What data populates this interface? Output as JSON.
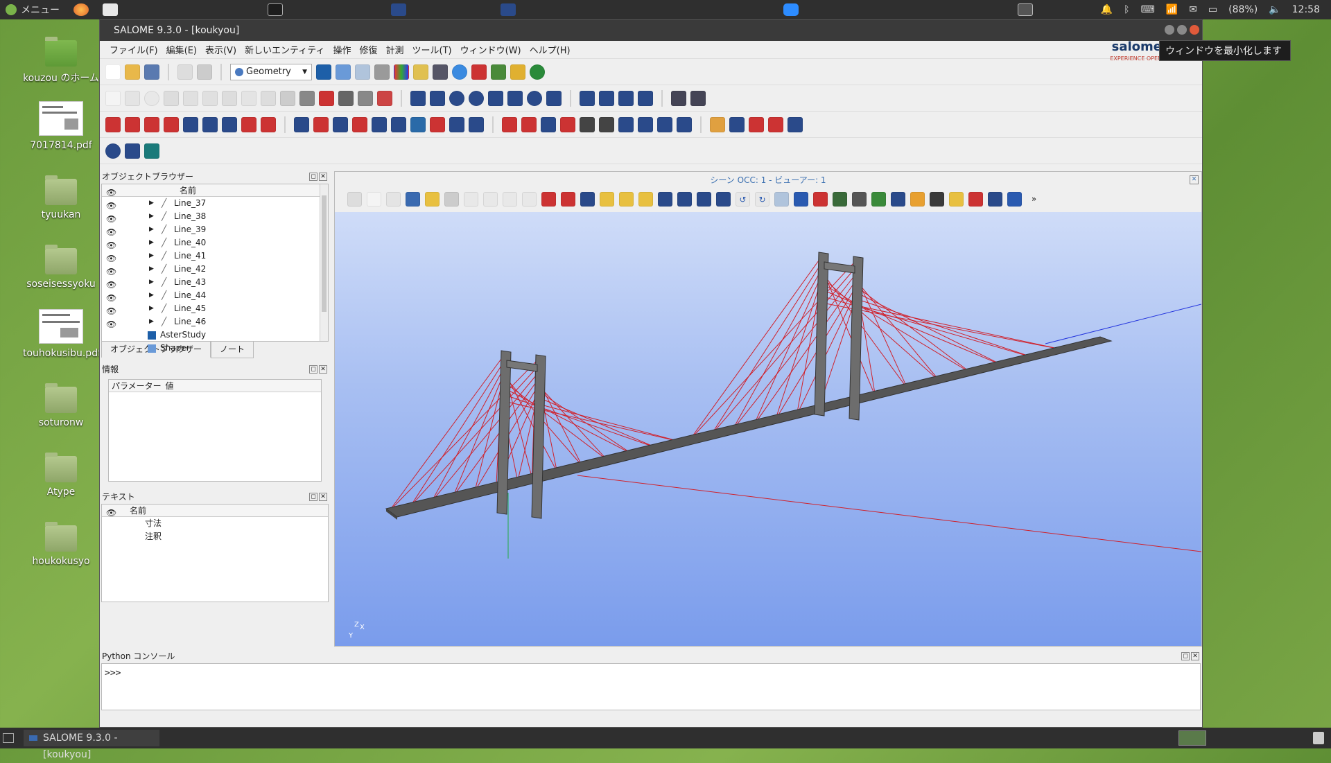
{
  "topbar": {
    "menu_label": "メニュー",
    "battery": "(88%)",
    "clock": "12:58"
  },
  "desktop": {
    "icons": [
      {
        "label": "kouzou のホーム",
        "kind": "home"
      },
      {
        "label": "7017814.pdf",
        "kind": "pdf"
      },
      {
        "label": "tyuukan",
        "kind": "folder"
      },
      {
        "label": "soseisessyoku",
        "kind": "folder"
      },
      {
        "label": "touhokusibu.pdf",
        "kind": "pdf"
      },
      {
        "label": "soturonw",
        "kind": "folder"
      },
      {
        "label": "Atype",
        "kind": "folder"
      },
      {
        "label": "houkokusyo",
        "kind": "folder"
      }
    ]
  },
  "window": {
    "title": "SALOME 9.3.0 - [koukyou]"
  },
  "menubar": {
    "items": [
      "ファイル(F)",
      "編集(E)",
      "表示(V)",
      "新しいエンティティ",
      "操作",
      "修復",
      "計測",
      "ツール(T)",
      "ウィンドウ(W)",
      "ヘルプ(H)"
    ]
  },
  "logo": {
    "name": "salome",
    "tag": "EXPERIENCE OPEN"
  },
  "module_selector": {
    "value": "Geometry"
  },
  "object_browser": {
    "title": "オブジェクトブラウザー",
    "column": "名前",
    "items": [
      "Line_37",
      "Line_38",
      "Line_39",
      "Line_40",
      "Line_41",
      "Line_42",
      "Line_43",
      "Line_44",
      "Line_45",
      "Line_46"
    ],
    "extra": [
      "AsterStudy",
      "Shaper"
    ],
    "tabs": [
      "オブジェクトブラウザー",
      "ノート"
    ]
  },
  "info_panel": {
    "title": "情報",
    "col1": "パラメーター",
    "col2": "値"
  },
  "text_panel": {
    "title": "テキスト",
    "column": "名前",
    "items": [
      "寸法",
      "注釈"
    ]
  },
  "viewer": {
    "title": "シーン OCC: 1 - ビューアー: 1",
    "axis_labels": [
      "Z",
      "X",
      "Y"
    ]
  },
  "python": {
    "title": "Python コンソール",
    "prompt": ">>>"
  },
  "tooltip": {
    "text": "ウィンドウを最小化します"
  },
  "taskbar": {
    "item": "SALOME 9.3.0 - [koukyou]"
  },
  "colors": {
    "cable": "#d0202a",
    "deck": "#555555",
    "tower": "#6d6d6d",
    "axis_blue": "#2233dd",
    "axis_green": "#22aa44"
  }
}
